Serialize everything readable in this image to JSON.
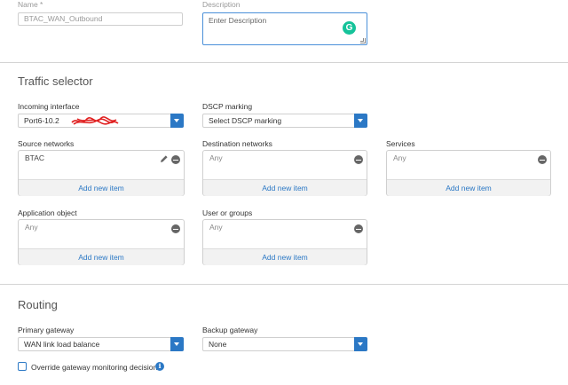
{
  "general": {
    "name_label": "Name *",
    "name_value": "BTAC_WAN_Outbound",
    "description_label": "Description",
    "description_placeholder": "Enter Description"
  },
  "traffic_selector": {
    "title": "Traffic selector",
    "incoming_interface_label": "Incoming interface",
    "incoming_interface_value": "Port6-10.2",
    "dscp_label": "DSCP marking",
    "dscp_value": "Select DSCP marking",
    "source_networks": {
      "label": "Source networks",
      "item": "BTAC",
      "add": "Add new item"
    },
    "destination_networks": {
      "label": "Destination networks",
      "item": "Any",
      "add": "Add new item"
    },
    "services": {
      "label": "Services",
      "item": "Any",
      "add": "Add new item"
    },
    "application_object": {
      "label": "Application object",
      "item": "Any",
      "add": "Add new item"
    },
    "user_or_groups": {
      "label": "User or groups",
      "item": "Any",
      "add": "Add new item"
    }
  },
  "routing": {
    "title": "Routing",
    "primary_gateway_label": "Primary gateway",
    "primary_gateway_value": "WAN link load balance",
    "backup_gateway_label": "Backup gateway",
    "backup_gateway_value": "None",
    "override_label": "Override gateway monitoring decision"
  },
  "colors": {
    "accent": "#2b78c5",
    "redaction": "#e02020",
    "grammarly": "#15c39a"
  }
}
